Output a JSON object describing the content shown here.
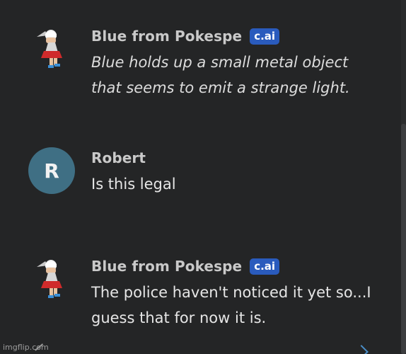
{
  "messages": [
    {
      "sender": "Blue from Pokespe",
      "badge": "c.ai",
      "text": "Blue holds up a small metal object that seems to emit a strange light.",
      "italic": true
    },
    {
      "sender": "Robert",
      "avatar_letter": "R",
      "text": "Is this legal"
    },
    {
      "sender": "Blue from Pokespe",
      "badge": "c.ai",
      "text": "The police haven't noticed it yet so...I guess that for now it is."
    }
  ],
  "watermark": "imgflip.com",
  "colors": {
    "background": "#242526",
    "badge": "#2a5bbd",
    "user_avatar": "#3f6f84"
  },
  "icons": {
    "character_avatar": "character-avatar-icon",
    "next": "chevron-right-icon"
  }
}
